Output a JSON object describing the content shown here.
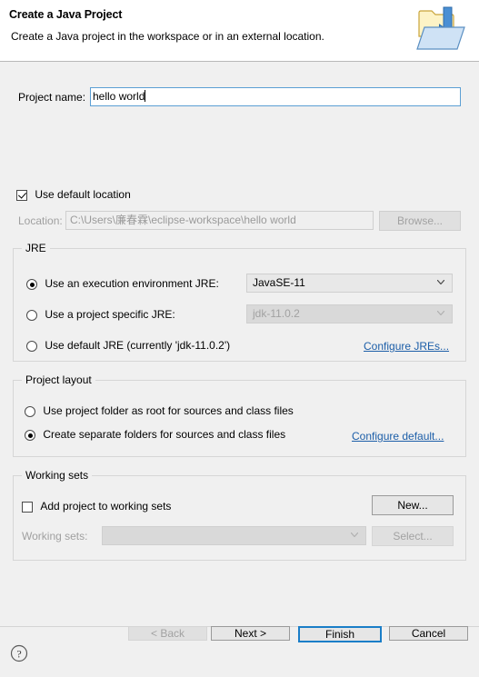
{
  "header": {
    "title": "Create a Java Project",
    "description": "Create a Java project in the workspace or in an external location.",
    "icon": "java-project-folder-icon"
  },
  "project_name": {
    "label": "Project name:",
    "value": "hello world",
    "focused": true
  },
  "location": {
    "use_default_label": "Use default location",
    "use_default_checked": true,
    "label": "Location:",
    "value": "C:\\Users\\廉春霖\\eclipse-workspace\\hello world",
    "browse_label": "Browse...",
    "browse_enabled": false
  },
  "jre": {
    "group_title": "JRE",
    "options": [
      {
        "label": "Use an execution environment JRE:",
        "selected": true,
        "combo_value": "JavaSE-11",
        "combo_enabled": true
      },
      {
        "label": "Use a project specific JRE:",
        "selected": false,
        "combo_value": "jdk-11.0.2",
        "combo_enabled": false
      },
      {
        "label": "Use default JRE (currently 'jdk-11.0.2')",
        "selected": false
      }
    ],
    "configure_link": "Configure JREs..."
  },
  "project_layout": {
    "group_title": "Project layout",
    "options": [
      {
        "label": "Use project folder as root for sources and class files",
        "selected": false
      },
      {
        "label": "Create separate folders for sources and class files",
        "selected": true
      }
    ],
    "configure_link": "Configure default..."
  },
  "working_sets": {
    "group_title": "Working sets",
    "add_label": "Add project to working sets",
    "add_checked": false,
    "new_label": "New...",
    "sets_label": "Working sets:",
    "sets_value": "",
    "select_label": "Select...",
    "select_enabled": false
  },
  "footer": {
    "help_icon": "help-question-icon",
    "back_label": "< Back",
    "back_enabled": false,
    "next_label": "Next >",
    "finish_label": "Finish",
    "cancel_label": "Cancel"
  },
  "colors": {
    "focus_blue": "#1a7ec8",
    "link_blue": "#1c5ea8",
    "body_bg": "#f0f0f0",
    "header_bg": "#ffffff"
  }
}
